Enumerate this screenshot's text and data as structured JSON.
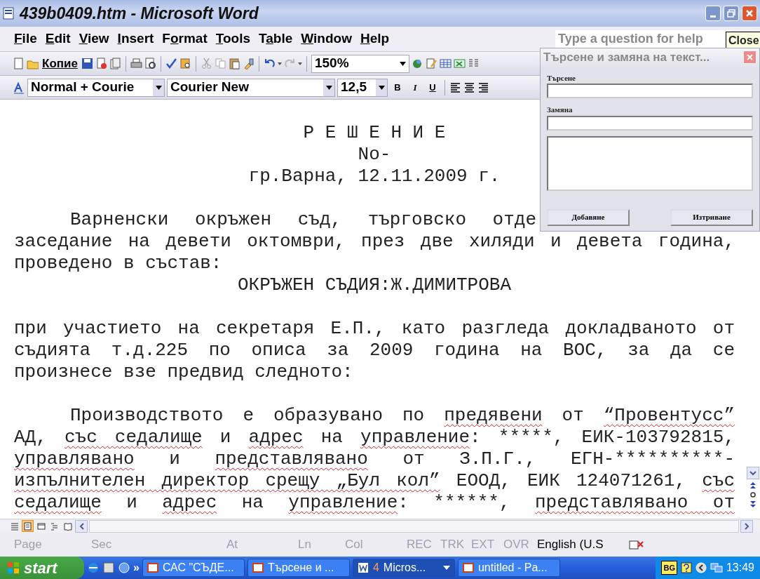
{
  "window": {
    "title": "439b0409.htm - Microsoft Word"
  },
  "menu": [
    {
      "access_key": "F",
      "rest": "ile"
    },
    {
      "access_key": "E",
      "rest": "dit"
    },
    {
      "access_key": "V",
      "rest": "iew"
    },
    {
      "access_key": "I",
      "rest": "nsert"
    },
    {
      "lead": "F",
      "access_key": "o",
      "rest": "rmat"
    },
    {
      "access_key": "T",
      "rest": "ools"
    },
    {
      "lead": "T",
      "access_key": "a",
      "rest": "ble"
    },
    {
      "access_key": "W",
      "rest": "indow"
    },
    {
      "access_key": "H",
      "rest": "elp"
    }
  ],
  "help_box": {
    "placeholder": "Type a question for help"
  },
  "tooltip": "Close",
  "standard_toolbar": {
    "copy_label": "Копие",
    "zoom": "150%"
  },
  "formatting_toolbar": {
    "style": "Normal + Courie",
    "font": "Courier New",
    "size": "12,5",
    "bold": "B",
    "italic": "I",
    "underline": "U"
  },
  "document": {
    "blocks": [
      {
        "lines": [
          {
            "kind": "center",
            "segments": [
              {
                "text": "Р Е Ш Е Н И Е",
                "misspelled": false
              }
            ]
          },
          {
            "kind": "center",
            "segments": [
              {
                "text": "No-",
                "misspelled": false
              }
            ]
          },
          {
            "kind": "center",
            "segments": [
              {
                "text": "гр.Варна, 12.11.2009 г.",
                "misspelled": false
              }
            ]
          }
        ]
      },
      {
        "lines": [
          {
            "kind": "covered",
            "segments": [
              {
                "text": "Варненски окръжен съд, търговско отде",
                "misspelled": false
              }
            ]
          },
          {
            "kind": "justify",
            "segments": [
              {
                "text": "заседание на девети октомври, през две хиляди и девета година,",
                "misspelled": false
              }
            ]
          },
          {
            "kind": "left",
            "segments": [
              {
                "text": "проведено в състав:",
                "misspelled": false
              }
            ]
          },
          {
            "kind": "center",
            "segments": [
              {
                "text": "ОКРЪЖЕН СЪДИЯ:Ж.ДИМИТРОВА",
                "misspelled": false
              }
            ]
          }
        ]
      },
      {
        "lines": [
          {
            "kind": "justify",
            "segments": [
              {
                "text": "при участието на секретаря Е.П., като разгледа докладваното от",
                "misspelled": false
              }
            ]
          },
          {
            "kind": "justify",
            "segments": [
              {
                "text": "съдията т.д.225 по описа за 2009 година на ВОС, за да се",
                "misspelled": false
              }
            ]
          },
          {
            "kind": "left",
            "segments": [
              {
                "text": "произнесе взе предвид следното:",
                "misspelled": false
              }
            ]
          }
        ]
      },
      {
        "lines": [
          {
            "kind": "indent",
            "segments": [
              {
                "text": "Производството е образувано по ",
                "misspelled": false
              },
              {
                "text": "предявени",
                "misspelled": true
              },
              {
                "text": " от ",
                "misspelled": false
              },
              {
                "text": "“Провентусс”",
                "misspelled": true
              }
            ]
          },
          {
            "kind": "justify",
            "segments": [
              {
                "text": "АД, ",
                "misspelled": false
              },
              {
                "text": "със седалище",
                "misspelled": true
              },
              {
                "text": " и ",
                "misspelled": false
              },
              {
                "text": "адрес",
                "misspelled": true
              },
              {
                "text": " на ",
                "misspelled": false
              },
              {
                "text": "управление",
                "misspelled": true
              },
              {
                "text": ": *****, ЕИК-103792815,",
                "misspelled": false
              }
            ]
          },
          {
            "kind": "justify",
            "segments": [
              {
                "text": "управлявано",
                "misspelled": true
              },
              {
                "text": " и ",
                "misspelled": false
              },
              {
                "text": "представлявано",
                "misspelled": true
              },
              {
                "text": " от З.П.Г., ЕГН-**********-",
                "misspelled": false
              }
            ]
          },
          {
            "kind": "justify",
            "segments": [
              {
                "text": "изпълнителен директор срещу „Бул кол”",
                "misspelled": true
              },
              {
                "text": " ЕООД, ЕИК 124071261, ",
                "misspelled": false
              },
              {
                "text": "със",
                "misspelled": true
              }
            ]
          },
          {
            "kind": "justify",
            "segments": [
              {
                "text": "седалище",
                "misspelled": true
              },
              {
                "text": " и ",
                "misspelled": false
              },
              {
                "text": "адрес",
                "misspelled": true
              },
              {
                "text": " на ",
                "misspelled": false
              },
              {
                "text": "управление",
                "misspelled": true
              },
              {
                "text": ": ******, ",
                "misspelled": false
              },
              {
                "text": "представлявано",
                "misspelled": true
              },
              {
                "text": " от",
                "misspelled": true
              }
            ]
          }
        ]
      }
    ]
  },
  "view_buttons": [
    {
      "selected": false
    },
    {
      "selected": true
    },
    {
      "selected": false
    },
    {
      "selected": false
    },
    {
      "selected": false
    }
  ],
  "dialog": {
    "title": "Търсене и замяна на текст...",
    "search_label": "Търсене",
    "replace_label": "Замяна",
    "buttons": [
      "Добавяне",
      "Изтриване"
    ]
  },
  "status_bar": [
    {
      "label": "Page",
      "disabled": true
    },
    {
      "label": "Sec",
      "disabled": true
    },
    {
      "label": "At",
      "disabled": true
    },
    {
      "label": "Ln",
      "disabled": true
    },
    {
      "label": "Col",
      "disabled": true
    },
    {
      "label": "REC",
      "disabled": true
    },
    {
      "label": "TRK",
      "disabled": true
    },
    {
      "label": "EXT",
      "disabled": true
    },
    {
      "label": "OVR",
      "disabled": true
    },
    {
      "label": "English (U.S",
      "disabled": false
    }
  ],
  "taskbar": {
    "start": "start",
    "quick_launch_more": "»",
    "tasks": [
      {
        "label": "САС \"СЪДЕ...",
        "selected": false
      },
      {
        "label": "Търсене и ...",
        "selected": false
      },
      {
        "count": "4",
        "label": "Micros...",
        "selected": true
      },
      {
        "label": "untitled - Pa...",
        "selected": false
      }
    ],
    "language": "BG",
    "clock": "13:49"
  }
}
